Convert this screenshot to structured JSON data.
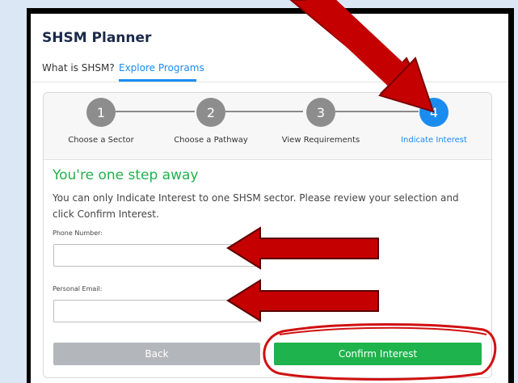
{
  "app": {
    "title": "SHSM Planner"
  },
  "tabs": [
    {
      "label": "What is SHSM?"
    },
    {
      "label": "Explore Programs"
    }
  ],
  "steps": [
    {
      "number": "1",
      "label": "Choose a Sector"
    },
    {
      "number": "2",
      "label": "Choose a Pathway"
    },
    {
      "number": "3",
      "label": "View Requirements"
    },
    {
      "number": "4",
      "label": "Indicate Interest"
    }
  ],
  "main": {
    "heading": "You're one step away",
    "description": "You can only Indicate Interest to one SHSM sector. Please review your selection and click Confirm Interest.",
    "phone_label": "Phone Number:",
    "phone_value": "",
    "email_label": "Personal Email:",
    "email_value": ""
  },
  "buttons": {
    "back": "Back",
    "confirm": "Confirm Interest"
  },
  "colors": {
    "accent": "#1a8cf0",
    "success": "#1eb34c",
    "annotation_arrow": "#c40000",
    "annotation_circle": "#d01010"
  },
  "annotations": [
    {
      "type": "arrow",
      "target": "step-4"
    },
    {
      "type": "arrow",
      "target": "phone-number-input"
    },
    {
      "type": "arrow",
      "target": "personal-email-input"
    },
    {
      "type": "circle",
      "target": "confirm-interest-button"
    }
  ]
}
